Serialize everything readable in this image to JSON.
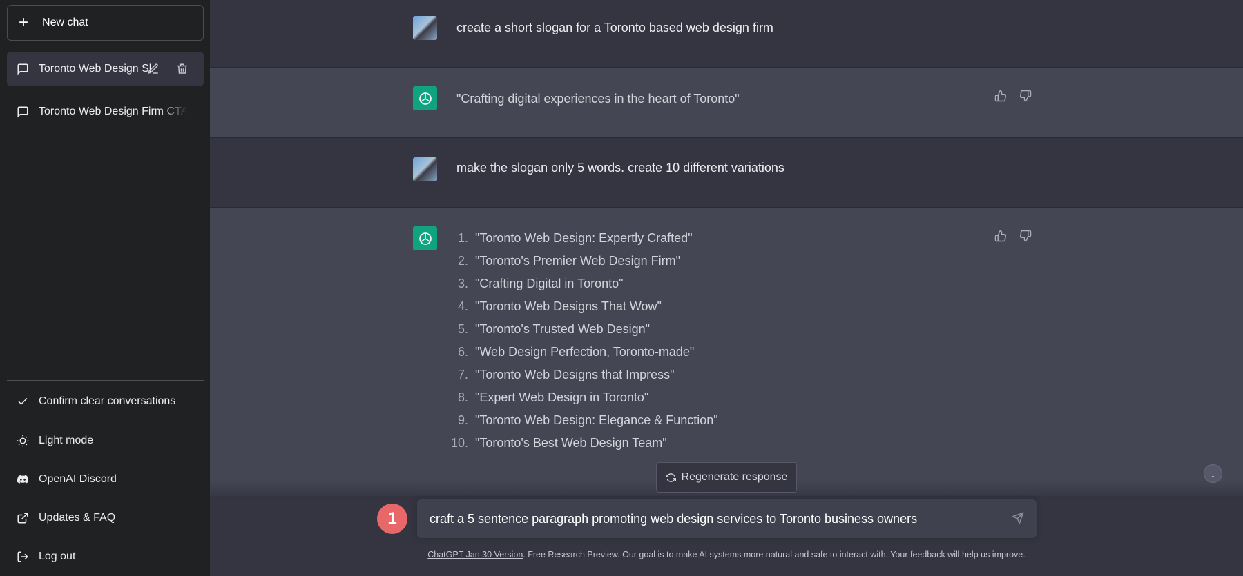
{
  "sidebar": {
    "new_chat": "New chat",
    "conversations": [
      {
        "title": "Toronto Web Design Sl",
        "active": true
      },
      {
        "title": "Toronto Web Design Firm CTA",
        "active": false
      }
    ],
    "bottom_items": [
      {
        "label": "Confirm clear conversations",
        "icon": "check-icon"
      },
      {
        "label": "Light mode",
        "icon": "sun-icon"
      },
      {
        "label": "OpenAI Discord",
        "icon": "discord-icon"
      },
      {
        "label": "Updates & FAQ",
        "icon": "external-link-icon"
      },
      {
        "label": "Log out",
        "icon": "logout-icon"
      }
    ]
  },
  "messages": [
    {
      "role": "user",
      "text": "create a short slogan for a Toronto based web design firm"
    },
    {
      "role": "assistant",
      "text": "\"Crafting digital experiences in the heart of Toronto\""
    },
    {
      "role": "user",
      "text": "make the slogan only 5 words. create 10 different variations"
    },
    {
      "role": "assistant",
      "list": [
        {
          "n": "1.",
          "text": "\"Toronto Web Design: Expertly Crafted\""
        },
        {
          "n": "2.",
          "text": "\"Toronto's Premier Web Design Firm\""
        },
        {
          "n": "3.",
          "text": "\"Crafting Digital in Toronto\""
        },
        {
          "n": "4.",
          "text": "\"Toronto Web Designs That Wow\""
        },
        {
          "n": "5.",
          "text": "\"Toronto's Trusted Web Design\""
        },
        {
          "n": "6.",
          "text": "\"Web Design Perfection, Toronto-made\""
        },
        {
          "n": "7.",
          "text": "\"Toronto Web Designs that Impress\""
        },
        {
          "n": "8.",
          "text": "\"Expert Web Design in Toronto\""
        },
        {
          "n": "9.",
          "text": "\"Toronto Web Design: Elegance & Function\""
        },
        {
          "n": "10.",
          "text": "\"Toronto's Best Web Design Team\""
        }
      ]
    }
  ],
  "regenerate_label": "Regenerate response",
  "annotation_badge": "1",
  "input_value": "craft a 5 sentence paragraph promoting web design services to Toronto business owners",
  "footer": {
    "link": "ChatGPT Jan 30 Version",
    "text": ". Free Research Preview. Our goal is to make AI systems more natural and safe to interact with. Your feedback will help us improve."
  },
  "colors": {
    "sidebar": "#202123",
    "user_row": "#343541",
    "assistant_row": "#444654",
    "gpt_avatar": "#10a37f",
    "badge": "#e8686a"
  }
}
